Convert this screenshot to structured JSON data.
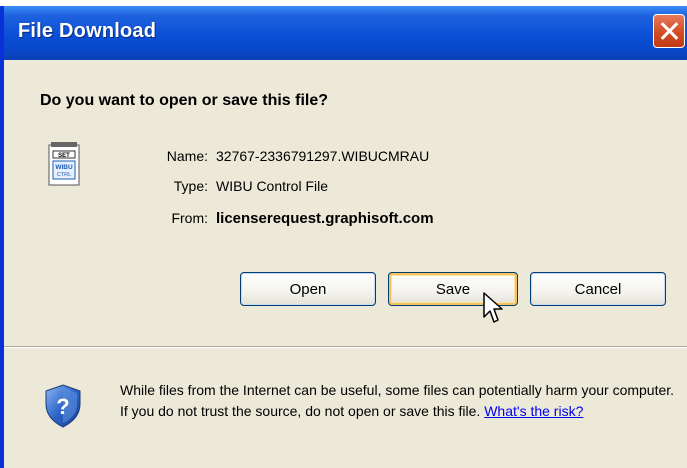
{
  "window": {
    "title": "File Download"
  },
  "dialog": {
    "question": "Do you want to open or save this file?",
    "file_icon": "wibu-file-icon",
    "name_label": "Name:",
    "name_value": "32767-2336791297.WIBUCMRAU",
    "type_label": "Type:",
    "type_value": "WIBU Control File",
    "from_label": "From:",
    "from_value": "licenserequest.graphisoft.com"
  },
  "buttons": {
    "open": "Open",
    "save": "Save",
    "cancel": "Cancel"
  },
  "warning": {
    "icon": "shield-question-icon",
    "text": "While files from the Internet can be useful, some files can potentially harm your computer. If you do not trust the source, do not open or save this file.",
    "link": "What's the risk?"
  },
  "colors": {
    "titlebar": "#0a4fd6",
    "window_bg": "#ece9d8",
    "close_button": "#d34b22",
    "link": "#0000ee"
  }
}
